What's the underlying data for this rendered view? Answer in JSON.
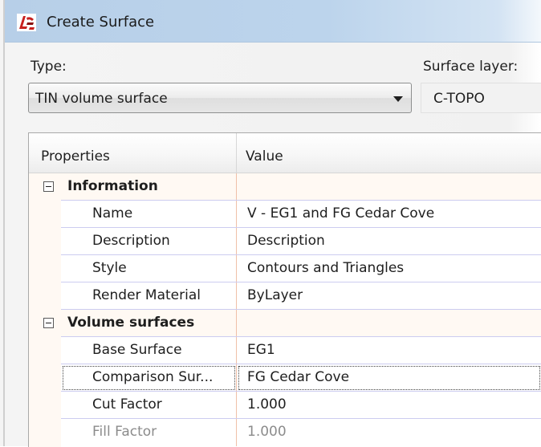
{
  "window": {
    "title": "Create Surface"
  },
  "type_field": {
    "label": "Type:",
    "value": "TIN volume surface"
  },
  "layer_field": {
    "label": "Surface layer:",
    "value": "C-TOPO"
  },
  "grid": {
    "headers": {
      "properties": "Properties",
      "value": "Value"
    },
    "categories": [
      {
        "title": "Information"
      },
      {
        "title": "Volume surfaces"
      }
    ],
    "information_rows": [
      {
        "name": "Name",
        "value": "V - EG1 and FG Cedar Cove"
      },
      {
        "name": "Description",
        "value": "Description"
      },
      {
        "name": "Style",
        "value": "Contours and Triangles"
      },
      {
        "name": "Render Material",
        "value": "ByLayer"
      }
    ],
    "volume_rows": [
      {
        "name": "Base Surface",
        "value": "EG1"
      },
      {
        "name": "Comparison Sur...",
        "value": "FG Cedar Cove"
      },
      {
        "name": "Cut Factor",
        "value": "1.000"
      },
      {
        "name": "Fill Factor",
        "value": "1.000"
      }
    ]
  },
  "colors": {
    "titlebar": "#bcd4ec",
    "category_bg": "#fff9f3",
    "row_rule": "#ccccf0",
    "column_rule": "#f0c0a8"
  },
  "icons": {
    "app": "autocad-civil-logo-icon",
    "expander": "collapse-minus-icon",
    "dropdown": "chevron-down-icon"
  }
}
